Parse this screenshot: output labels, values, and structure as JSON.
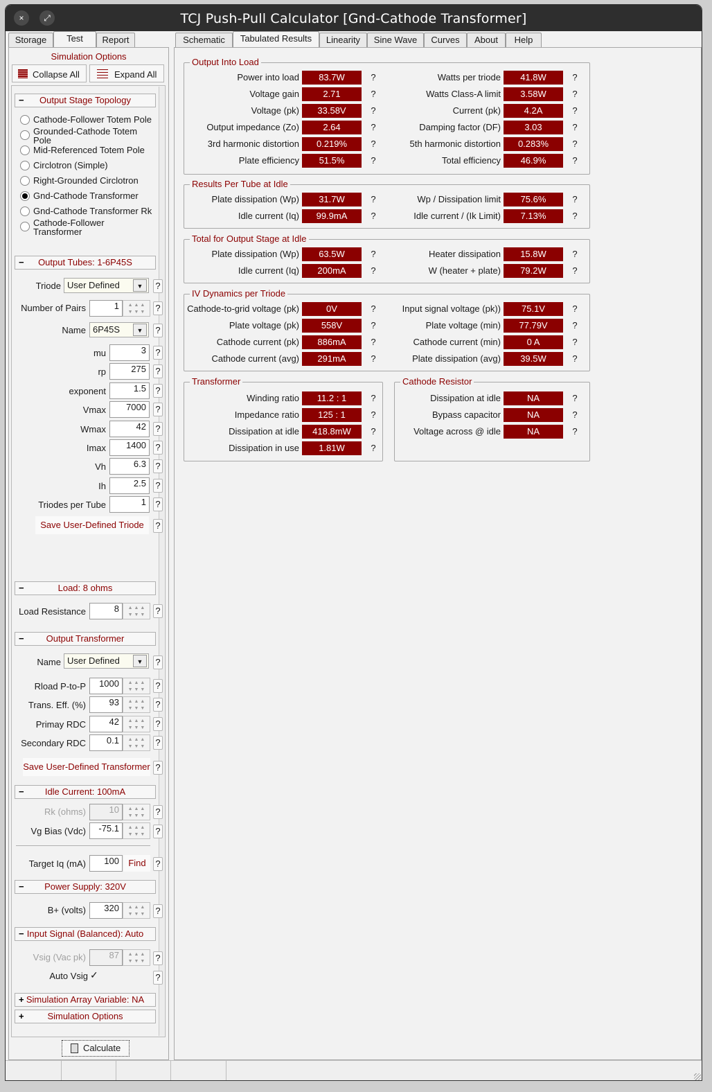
{
  "window": {
    "title": "TCJ Push-Pull Calculator [Gnd-Cathode Transformer]",
    "close_icon": "×",
    "max_icon": "⤢"
  },
  "left_tabs": [
    "Storage",
    "Test",
    "Report"
  ],
  "right_tabs": [
    "Schematic",
    "Tabulated Results",
    "Linearity",
    "Sine Wave",
    "Curves",
    "About",
    "Help"
  ],
  "sim_options_label": "Simulation Options",
  "collapse_all": "Collapse All",
  "expand_all": "Expand All",
  "topology": {
    "header": "Output Stage Topology",
    "options": [
      "Cathode-Follower Totem Pole",
      "Grounded-Cathode Totem\nPole",
      "Mid-Referenced Totem Pole",
      "Circlotron (Simple)",
      "Right-Grounded Circlotron",
      "Gnd-Cathode Transformer",
      "Gnd-Cathode Transformer Rk",
      "Cathode-Follower\nTransformer"
    ],
    "selected": 5
  },
  "tubes": {
    "header": "Output Tubes: 1-6P45S",
    "triode_label": "Triode",
    "triode_value": "User Defined",
    "pairs_label": "Number of Pairs",
    "pairs_value": "1",
    "name_label": "Name",
    "name_value": "6P45S",
    "params": [
      {
        "label": "mu",
        "value": "3"
      },
      {
        "label": "rp",
        "value": "275"
      },
      {
        "label": "exponent",
        "value": "1.5"
      },
      {
        "label": "Vmax",
        "value": "7000"
      },
      {
        "label": "Wmax",
        "value": "42"
      },
      {
        "label": "Imax",
        "value": "1400"
      },
      {
        "label": "Vh",
        "value": "6.3"
      },
      {
        "label": "Ih",
        "value": "2.5"
      },
      {
        "label": "Triodes per Tube",
        "value": "1"
      }
    ],
    "save_button": "Save User-Defined Triode"
  },
  "load": {
    "header": "Load: 8 ohms",
    "label": "Load Resistance",
    "value": "8"
  },
  "transformer": {
    "header": "Output Transformer",
    "name_label": "Name",
    "name_value": "User Defined",
    "params": [
      {
        "label": "Rload P-to-P",
        "value": "1000"
      },
      {
        "label": "Trans. Eff. (%)",
        "value": "93"
      },
      {
        "label": "Primay RDC",
        "value": "42"
      },
      {
        "label": "Secondary RDC",
        "value": "0.1"
      }
    ],
    "save_button": "Save User-Defined Transformer"
  },
  "idle": {
    "header": "Idle Current: 100mA",
    "rk_label": "Rk (ohms)",
    "rk_value": "10",
    "vg_label": "Vg Bias (Vdc)",
    "vg_value": "-75.1",
    "target_label": "Target Iq (mA)",
    "target_value": "100",
    "find_button": "Find"
  },
  "power": {
    "header": "Power Supply: 320V",
    "label": "B+ (volts)",
    "value": "320"
  },
  "input_signal": {
    "header": "Input Signal (Balanced): Auto",
    "vsig_label": "Vsig (Vac pk)",
    "vsig_value": "87",
    "auto_label": "Auto Vsig",
    "auto_check": "✓"
  },
  "sim_array": {
    "header": "Simulation Array Variable: NA"
  },
  "sim_options": {
    "header": "Simulation Options"
  },
  "calculate": "Calculate",
  "q": "?",
  "minus": "−",
  "plus": "+",
  "results": {
    "output_into_load": {
      "title": "Output Into Load",
      "left": [
        {
          "label": "Power into load",
          "value": "83.7W"
        },
        {
          "label": "Voltage gain",
          "value": "2.71"
        },
        {
          "label": "Voltage (pk)",
          "value": "33.58V"
        },
        {
          "label": "Output impedance (Zo)",
          "value": "2.64"
        },
        {
          "label": "3rd harmonic distortion",
          "value": "0.219%"
        },
        {
          "label": "Plate efficiency",
          "value": "51.5%"
        }
      ],
      "right": [
        {
          "label": "Watts per triode",
          "value": "41.8W"
        },
        {
          "label": "Watts Class-A limit",
          "value": "3.58W"
        },
        {
          "label": "Current (pk)",
          "value": "4.2A"
        },
        {
          "label": "Damping factor (DF)",
          "value": "3.03"
        },
        {
          "label": "5th harmonic distortion",
          "value": "0.283%"
        },
        {
          "label": "Total efficiency",
          "value": "46.9%"
        }
      ]
    },
    "per_tube": {
      "title": "Results Per Tube at Idle",
      "left": [
        {
          "label": "Plate dissipation (Wp)",
          "value": "31.7W"
        },
        {
          "label": "Idle current (Iq)",
          "value": "99.9mA"
        }
      ],
      "right": [
        {
          "label": "Wp / Dissipation limit",
          "value": "75.6%"
        },
        {
          "label": "Idle current / (Ik Limit)",
          "value": "7.13%"
        }
      ]
    },
    "total_stage": {
      "title": "Total for Output Stage at Idle",
      "left": [
        {
          "label": "Plate dissipation (Wp)",
          "value": "63.5W"
        },
        {
          "label": "Idle current (Iq)",
          "value": "200mA"
        }
      ],
      "right": [
        {
          "label": "Heater dissipation",
          "value": "15.8W"
        },
        {
          "label": "W (heater + plate)",
          "value": "79.2W"
        }
      ]
    },
    "iv_dynamics": {
      "title": "IV Dynamics per Triode",
      "left": [
        {
          "label": "Cathode-to-grid voltage (pk)",
          "value": "0V"
        },
        {
          "label": "Plate voltage (pk)",
          "value": "558V"
        },
        {
          "label": "Cathode current (pk)",
          "value": "886mA"
        },
        {
          "label": "Cathode current (avg)",
          "value": "291mA"
        }
      ],
      "right": [
        {
          "label": "Input signal voltage (pk))",
          "value": "75.1V"
        },
        {
          "label": "Plate voltage (min)",
          "value": "77.79V"
        },
        {
          "label": "Cathode current (min)",
          "value": "0 A"
        },
        {
          "label": "Plate dissipation (avg)",
          "value": "39.5W"
        }
      ]
    },
    "transformer": {
      "title": "Transformer",
      "rows": [
        {
          "label": "Winding ratio",
          "value": "11.2 : 1"
        },
        {
          "label": "Impedance ratio",
          "value": "125 : 1"
        },
        {
          "label": "Dissipation at idle",
          "value": "418.8mW"
        },
        {
          "label": "Dissipation in use",
          "value": "1.81W"
        }
      ]
    },
    "cathode_resistor": {
      "title": "Cathode Resistor",
      "rows": [
        {
          "label": "Dissipation at idle",
          "value": "NA"
        },
        {
          "label": "Bypass capacitor",
          "value": "NA"
        },
        {
          "label": "Voltage across @ idle",
          "value": "NA"
        }
      ]
    }
  }
}
